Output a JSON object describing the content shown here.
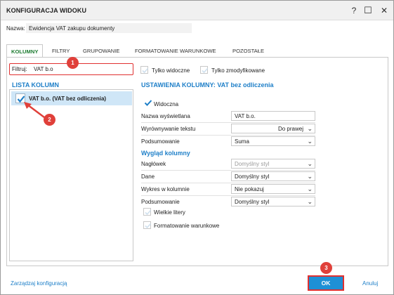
{
  "window": {
    "title": "KONFIGURACJA WIDOKU",
    "help_icon": "question-icon",
    "maximize_icon": "maximize-icon",
    "close_icon": "close-icon",
    "help_glyph": "?",
    "max_glyph": "☐",
    "close_glyph": "✕"
  },
  "name": {
    "label": "Nazwa:",
    "value": "Ewidencja VAT zakupu dokumenty"
  },
  "tabs": [
    {
      "label": "KOLUMNY",
      "active": true
    },
    {
      "label": "FILTRY",
      "active": false
    },
    {
      "label": "GRUPOWANIE",
      "active": false
    },
    {
      "label": "FORMATOWANIE WARUNKOWE",
      "active": false
    },
    {
      "label": "POZOSTAŁE",
      "active": false
    }
  ],
  "filter": {
    "label": "Filtruj:",
    "value": "VAT b.o"
  },
  "options": {
    "visible_only": "Tylko widoczne",
    "modified_only": "Tylko zmodyfikowane"
  },
  "column_list": {
    "title": "LISTA KOLUMN",
    "items": [
      {
        "label": "VAT b.o. (VAT bez odliczenia)",
        "checked": true
      }
    ]
  },
  "settings": {
    "title": "USTAWIENIA KOLUMNY: VAT bez odliczenia",
    "visible_label": "Widoczna",
    "display_name_label": "Nazwa wyświetlana",
    "display_name_value": "VAT b.o.",
    "alignment_label": "Wyrównywanie tekstu",
    "alignment_value": "Do prawej",
    "summary_label": "Podsumowanie",
    "summary_value": "Suma"
  },
  "appearance": {
    "title": "Wygląd kolumny",
    "header_label": "Nagłówek",
    "header_value": "Domyślny styl",
    "data_label": "Dane",
    "data_value": "Domyślny styl",
    "chart_label": "Wykres w kolumnie",
    "chart_value": "Nie pokazuj",
    "summary_label": "Podsumowanie",
    "summary_value": "Domyślny styl",
    "uppercase_label": "Wielkie litery",
    "conditional_label": "Formatowanie warunkowe"
  },
  "footer": {
    "manage_link": "Zarządzaj konfiguracją",
    "ok_label": "OK",
    "cancel_label": "Anuluj"
  },
  "annotations": {
    "badge1": "1",
    "badge2": "2",
    "badge3": "3"
  },
  "colors": {
    "accent_blue": "#1e7fc8",
    "active_tab_green": "#1b7a2f",
    "annotation_red": "#e0403a",
    "ok_button": "#1e90d6",
    "selected_row": "#cfe6f7"
  }
}
